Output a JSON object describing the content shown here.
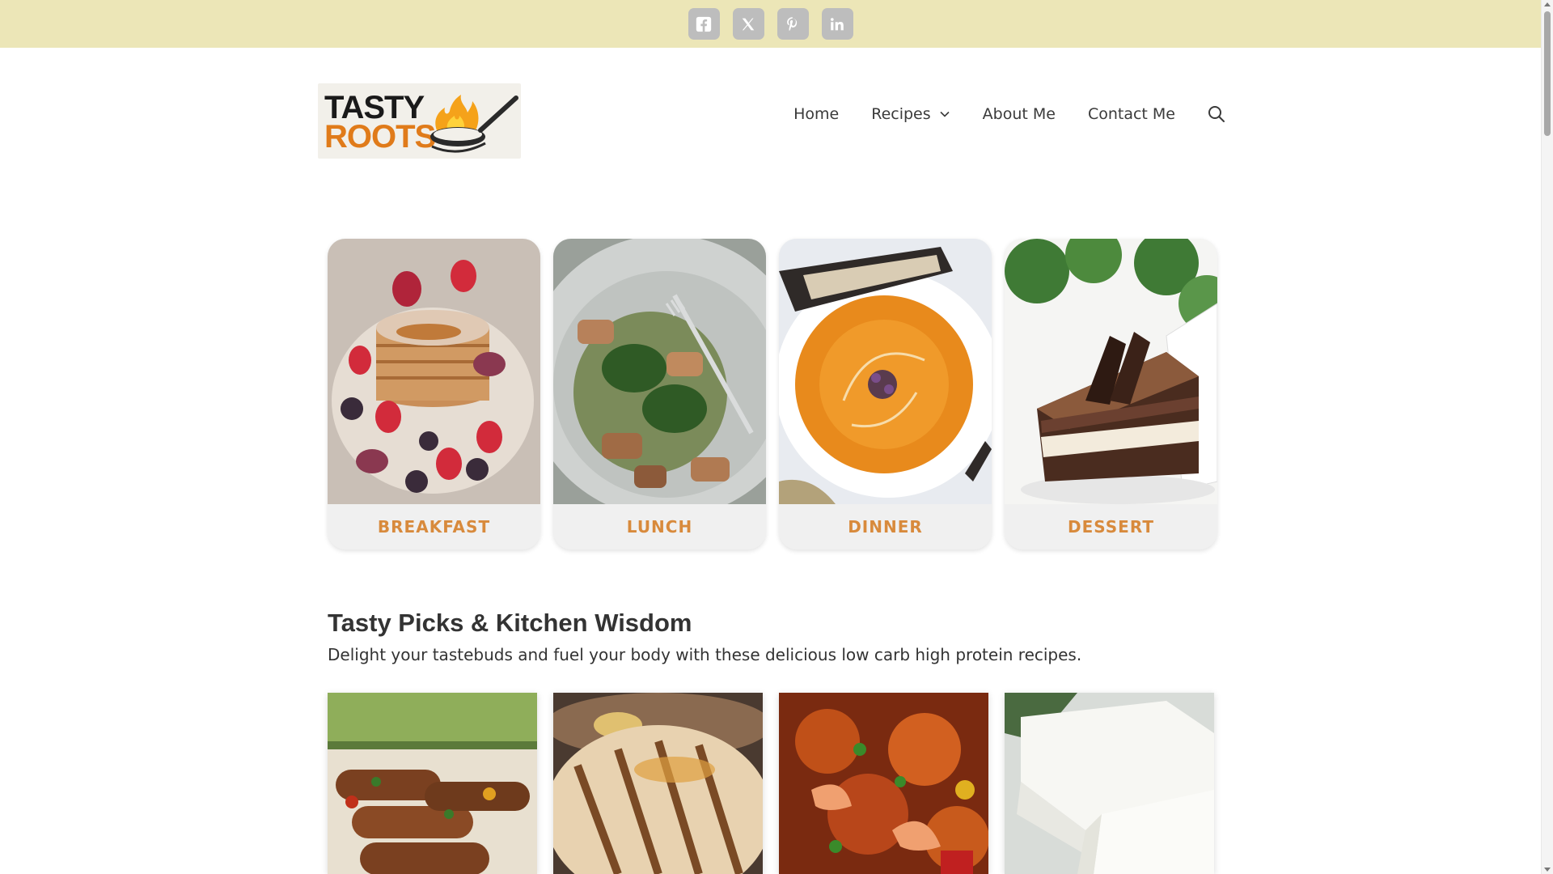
{
  "social": [
    {
      "name": "facebook",
      "icon": "facebook-icon",
      "glyph": "f"
    },
    {
      "name": "x",
      "icon": "x-twitter-icon",
      "glyph": "𝕏"
    },
    {
      "name": "pinterest",
      "icon": "pinterest-icon",
      "glyph": "P"
    },
    {
      "name": "linkedin",
      "icon": "linkedin-icon",
      "glyph": "in"
    }
  ],
  "logo": {
    "line1": "TASTY",
    "line2": "ROOTS"
  },
  "nav": {
    "home": "Home",
    "recipes": "Recipes",
    "about": "About Me",
    "contact": "Contact Me"
  },
  "categories": [
    {
      "label": "BREAKFAST"
    },
    {
      "label": "LUNCH"
    },
    {
      "label": "DINNER"
    },
    {
      "label": "DESSERT"
    }
  ],
  "section": {
    "title": "Tasty Picks & Kitchen Wisdom",
    "subtitle": "Delight your tastebuds and fuel your body with these delicious low carb high protein recipes."
  },
  "colors": {
    "topbar": "#ece6b7",
    "social_bg": "#bdbdbd",
    "category_label": "#d88a3c",
    "logo_orange": "#e07b1a"
  }
}
